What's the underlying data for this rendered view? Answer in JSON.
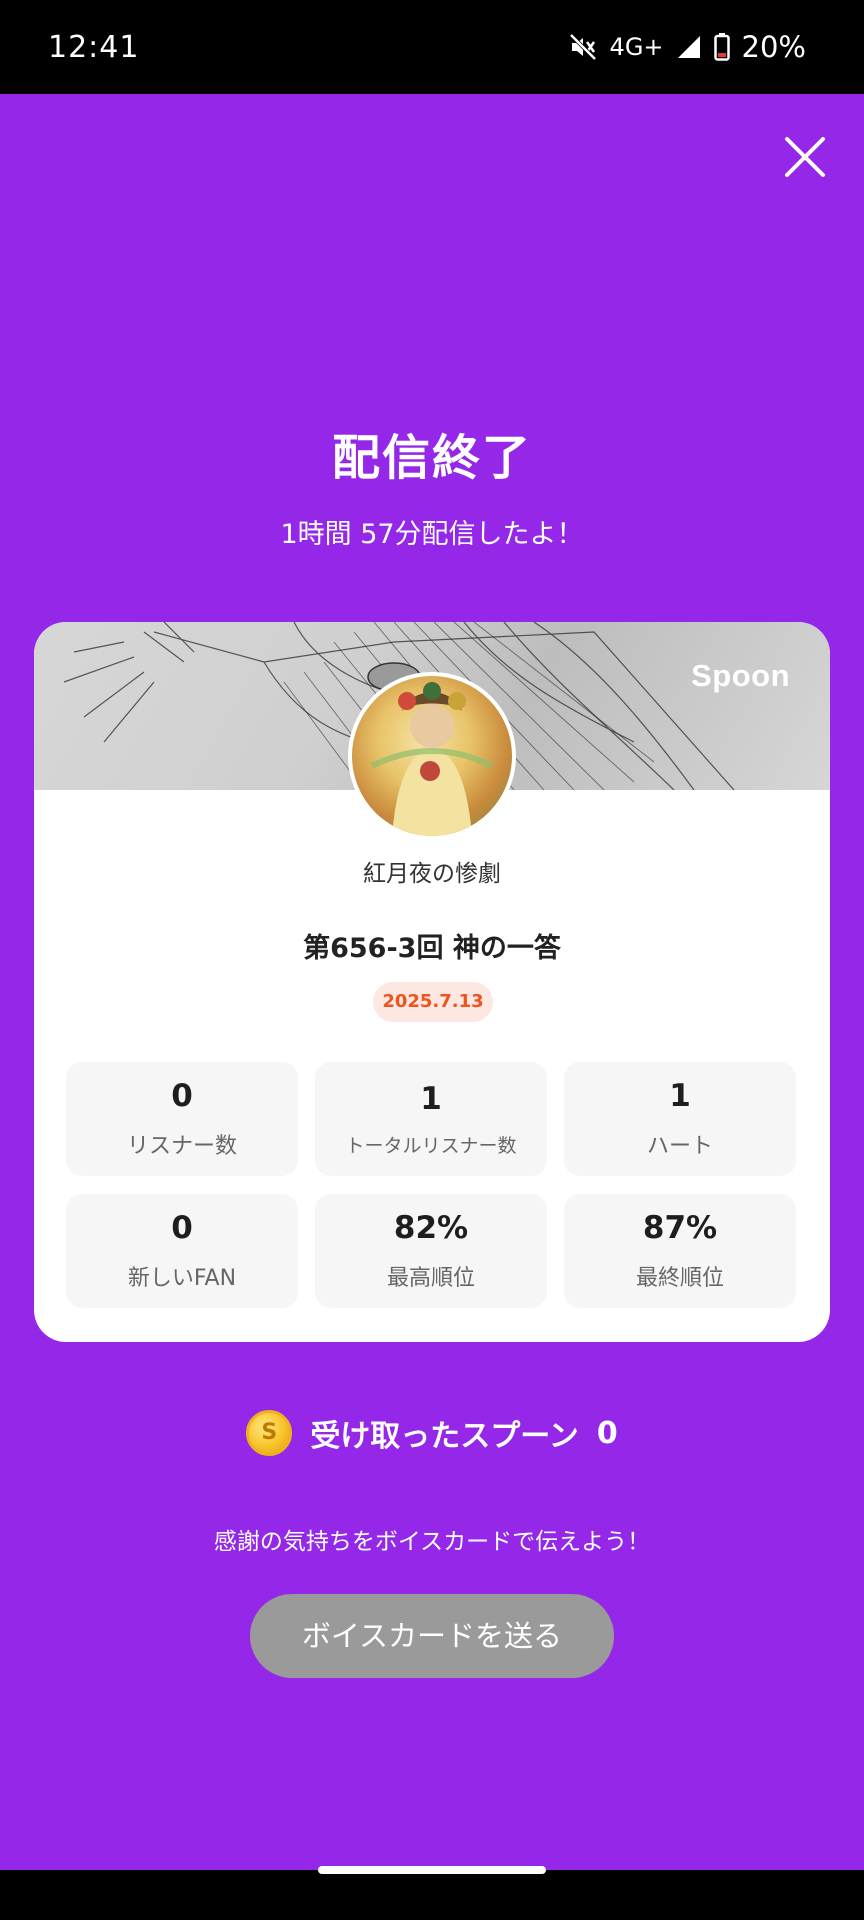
{
  "status_bar": {
    "time": "12:41",
    "network": "4G+",
    "battery": "20%",
    "icons": [
      "mute-icon",
      "signal-icon",
      "battery-icon"
    ]
  },
  "title": "配信終了",
  "duration": "1時間 57分配信したよ！",
  "card": {
    "brand": "Spoon",
    "dj_name": "紅月夜の惨劇",
    "live_title": "第656-3回 神の一答",
    "date": "2025.7.13",
    "stats": [
      {
        "value": "0",
        "label": "リスナー数"
      },
      {
        "value": "1",
        "label": "トータルリスナー数"
      },
      {
        "value": "1",
        "label": "ハート"
      },
      {
        "value": "0",
        "label": "新しいFAN"
      },
      {
        "value": "82%",
        "label": "最高順位"
      },
      {
        "value": "87%",
        "label": "最終順位"
      }
    ]
  },
  "spoons": {
    "coin_symbol": "S",
    "label": "受け取ったスプーン",
    "count": "0"
  },
  "thanks_text": "感謝の気持ちをボイスカードで伝えよう！",
  "voice_card_button": "ボイスカードを送る",
  "colors": {
    "background": "#9427e8",
    "badge_text": "#f0531c",
    "badge_bg": "#fde7e2",
    "button_bg": "#9a9a9a"
  }
}
